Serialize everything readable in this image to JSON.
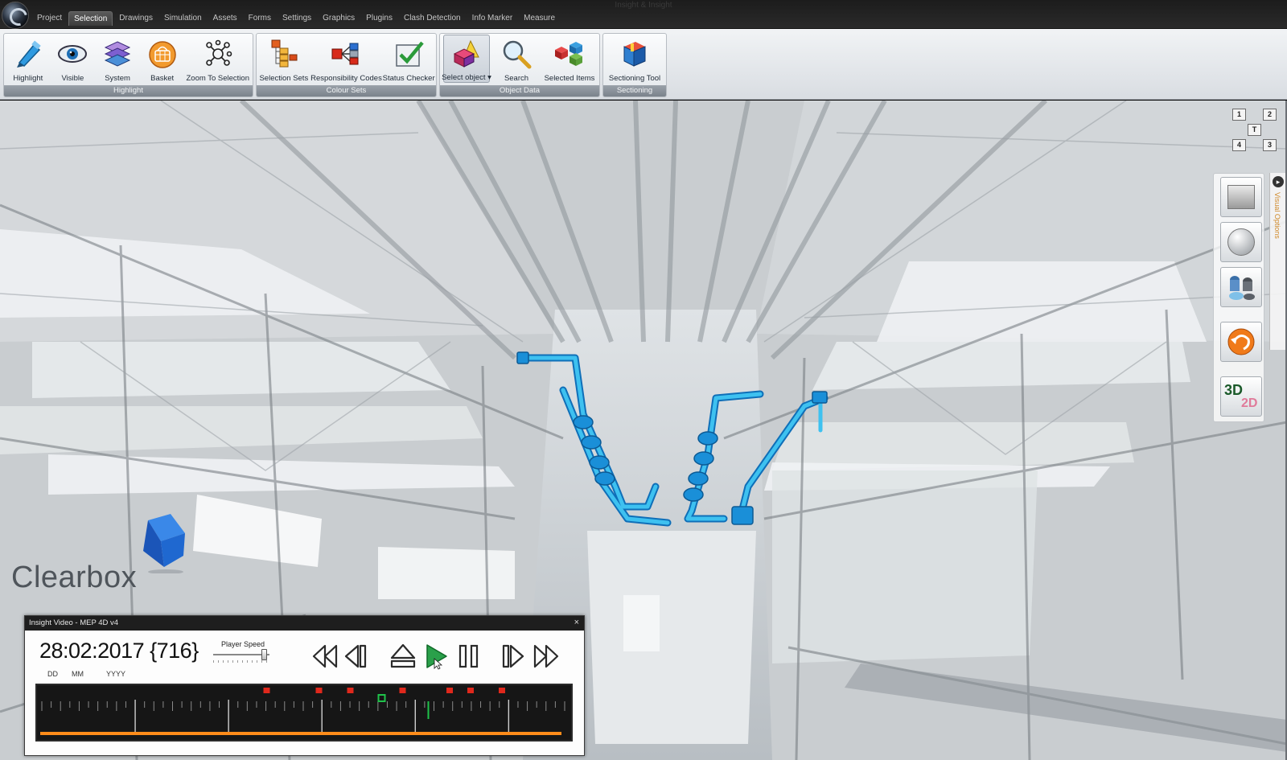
{
  "window": {
    "title": "Insight & Insight"
  },
  "menu": {
    "tabs": [
      "Project",
      "Selection",
      "Drawings",
      "Simulation",
      "Assets",
      "Forms",
      "Settings",
      "Graphics",
      "Plugins",
      "Clash Detection",
      "Info Marker",
      "Measure"
    ],
    "active": "Selection"
  },
  "ribbon": {
    "highlight": {
      "title": "Highlight",
      "buttons": [
        "Highlight",
        "Visible",
        "System",
        "Basket",
        "Zoom To Selection"
      ]
    },
    "colour_sets": {
      "title": "Colour Sets",
      "buttons": [
        "Selection Sets",
        "Responsibility Codes",
        "Status Checker"
      ]
    },
    "object_data": {
      "title": "Object Data",
      "buttons": [
        "Select object ▾",
        "Search",
        "Selected Items"
      ]
    },
    "sectioning": {
      "title": "Sectioning",
      "buttons": [
        "Sectioning Tool"
      ]
    }
  },
  "view_cube": {
    "labels": [
      "1",
      "2",
      "T",
      "4",
      "3"
    ]
  },
  "side_tools": {
    "mode_3d": "3D",
    "mode_2d": "2D"
  },
  "visual_options": {
    "label": "Visual Options"
  },
  "logo": {
    "text": "Clearbox"
  },
  "player": {
    "title": "Insight Video - MEP 4D v4",
    "close": "×",
    "date": "28:02:2017 {716}",
    "date_units": [
      "DD",
      "MM",
      "YYYY"
    ],
    "speed_label": "Player Speed",
    "speed_level": 0.92,
    "progress": 1.0,
    "event_markers": [
      0.43,
      0.53,
      0.59,
      0.69,
      0.78,
      0.82,
      0.88
    ],
    "current_marker": 0.65
  },
  "colors": {
    "accent_orange": "#ff8c1a",
    "pipe_blue": "#1a8fd8",
    "marker_red": "#e0281c",
    "marker_green": "#1fc24a"
  }
}
